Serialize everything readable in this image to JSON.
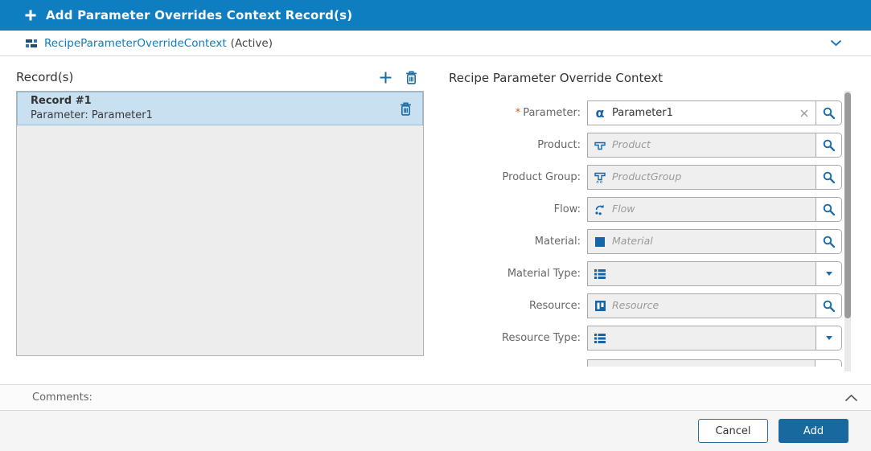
{
  "title_bar": {
    "title": "Add Parameter Overrides Context Record(s)"
  },
  "entity_bar": {
    "entity_name": "RecipeParameterOverrideContext",
    "entity_status": "(Active)"
  },
  "records_panel": {
    "title": "Record(s)",
    "records": [
      {
        "title": "Record #1",
        "subtitle": "Parameter: Parameter1"
      }
    ]
  },
  "form": {
    "title": "Recipe Parameter Override Context",
    "required_marker": "*",
    "alpha_glyph": "α",
    "fields": [
      {
        "label": "Parameter:",
        "required": true,
        "icon": "alpha-icon",
        "value": "Parameter1",
        "control": "lookup"
      },
      {
        "label": "Product:",
        "required": false,
        "icon": "product-icon",
        "placeholder": "Product",
        "control": "lookup"
      },
      {
        "label": "Product Group:",
        "required": false,
        "icon": "product-group-icon",
        "placeholder": "ProductGroup",
        "control": "lookup"
      },
      {
        "label": "Flow:",
        "required": false,
        "icon": "flow-icon",
        "placeholder": "Flow",
        "control": "lookup"
      },
      {
        "label": "Material:",
        "required": false,
        "icon": "material-icon",
        "placeholder": "Material",
        "control": "lookup"
      },
      {
        "label": "Material Type:",
        "required": false,
        "icon": "list-icon",
        "control": "dropdown"
      },
      {
        "label": "Resource:",
        "required": false,
        "icon": "resource-icon",
        "placeholder": "Resource",
        "control": "lookup"
      },
      {
        "label": "Resource Type:",
        "required": false,
        "icon": "list-icon",
        "control": "dropdown"
      }
    ]
  },
  "comments": {
    "label": "Comments:"
  },
  "footer": {
    "cancel_label": "Cancel",
    "add_label": "Add"
  },
  "colors": {
    "accent_blue": "#0E7EC1",
    "icon_blue": "#1565A8",
    "action_blue": "#1B6CA5",
    "add_button_blue": "#17699E",
    "selected_row_bg": "#C9E0F1",
    "required_orange": "#C75F1E"
  }
}
